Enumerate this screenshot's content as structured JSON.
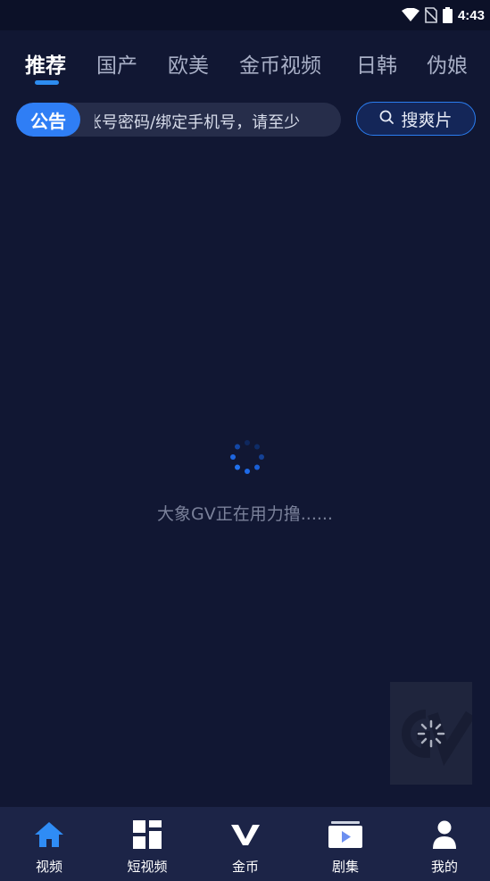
{
  "status_bar": {
    "time": "4:43",
    "icons": [
      "wifi-icon",
      "no-sim-icon",
      "battery-icon"
    ]
  },
  "tabs": [
    {
      "label": "推荐",
      "active": true
    },
    {
      "label": "国产",
      "active": false
    },
    {
      "label": "欧美",
      "active": false
    },
    {
      "label": "金币视频",
      "active": false
    },
    {
      "label": "日韩",
      "active": false
    },
    {
      "label": "伪娘",
      "active": false
    }
  ],
  "notice": {
    "badge": "公告",
    "text": "账号密码/绑定手机号，请至少"
  },
  "search": {
    "label": "搜爽片",
    "icon": "search-icon"
  },
  "loading": {
    "text": "大象GV正在用力撸......"
  },
  "bottom_nav": [
    {
      "label": "视频",
      "icon": "home-icon",
      "active": true
    },
    {
      "label": "短视频",
      "icon": "grid-icon",
      "active": false
    },
    {
      "label": "金币",
      "icon": "v-logo-icon",
      "active": false
    },
    {
      "label": "剧集",
      "icon": "play-screen-icon",
      "active": false
    },
    {
      "label": "我的",
      "icon": "user-icon",
      "active": false
    }
  ],
  "colors": {
    "background": "#111733",
    "accent": "#2f7ef5",
    "bottom_nav_bg": "#1c2447"
  }
}
